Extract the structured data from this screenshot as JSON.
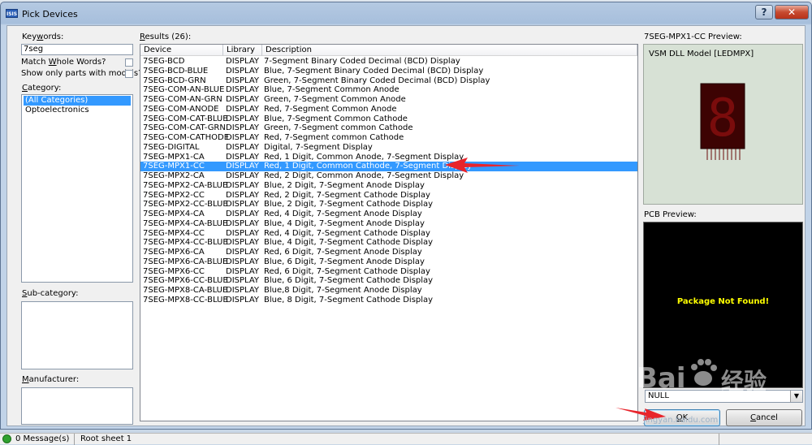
{
  "window": {
    "logo_text": "ISIS",
    "title": "Pick Devices",
    "help_label": "?",
    "close_label": "✕"
  },
  "keywords": {
    "label_prefix": "Key",
    "label_accel": "w",
    "label_suffix": "ords:",
    "value": "7seg"
  },
  "options": {
    "match_whole_prefix": "Match ",
    "match_whole_accel": "W",
    "match_whole_suffix": "hole Words?",
    "show_models": "Show only parts with models?"
  },
  "category": {
    "label_accel": "C",
    "label_suffix": "ategory:",
    "items": [
      "(All Categories)",
      "Optoelectronics"
    ],
    "selected_index": 0
  },
  "subcategory": {
    "label_accel": "S",
    "label_suffix": "ub-category:"
  },
  "manufacturer": {
    "label_accel": "M",
    "label_suffix": "anufacturer:"
  },
  "results": {
    "label_accel": "R",
    "label_suffix": "esults (26):",
    "headers": [
      "Device",
      "Library",
      "Description"
    ],
    "selected_index": 11,
    "rows": [
      {
        "device": "7SEG-BCD",
        "library": "DISPLAY",
        "description": "7-Segment Binary Coded Decimal (BCD) Display"
      },
      {
        "device": "7SEG-BCD-BLUE",
        "library": "DISPLAY",
        "description": "Blue,  7-Segment Binary Coded Decimal (BCD) Display"
      },
      {
        "device": "7SEG-BCD-GRN",
        "library": "DISPLAY",
        "description": "Green, 7-Segment Binary Coded Decimal (BCD) Display"
      },
      {
        "device": "7SEG-COM-AN-BLUE",
        "library": "DISPLAY",
        "description": "Blue, 7-Segment Common Anode"
      },
      {
        "device": "7SEG-COM-AN-GRN",
        "library": "DISPLAY",
        "description": "Green, 7-Segment Common Anode"
      },
      {
        "device": "7SEG-COM-ANODE",
        "library": "DISPLAY",
        "description": "Red, 7-Segment Common Anode"
      },
      {
        "device": "7SEG-COM-CAT-BLUE",
        "library": "DISPLAY",
        "description": "Blue, 7-Segment Common Cathode"
      },
      {
        "device": "7SEG-COM-CAT-GRN",
        "library": "DISPLAY",
        "description": "Green, 7-Segment common Cathode"
      },
      {
        "device": "7SEG-COM-CATHODE",
        "library": "DISPLAY",
        "description": "Red, 7-Segment common Cathode"
      },
      {
        "device": "7SEG-DIGITAL",
        "library": "DISPLAY",
        "description": "Digital, 7-Segment Display"
      },
      {
        "device": "7SEG-MPX1-CA",
        "library": "DISPLAY",
        "description": "Red, 1 Digit, Common Anode, 7-Segment Display"
      },
      {
        "device": "7SEG-MPX1-CC",
        "library": "DISPLAY",
        "description": "Red, 1 Digit, Common Cathode, 7-Segment Display"
      },
      {
        "device": "7SEG-MPX2-CA",
        "library": "DISPLAY",
        "description": "Red, 2 Digit, Common Anode, 7-Segment Display"
      },
      {
        "device": "7SEG-MPX2-CA-BLUE",
        "library": "DISPLAY",
        "description": "Blue, 2 Digit, 7-Segment Anode Display"
      },
      {
        "device": "7SEG-MPX2-CC",
        "library": "DISPLAY",
        "description": "Red, 2 Digit, 7-Segment Cathode Display"
      },
      {
        "device": "7SEG-MPX2-CC-BLUE",
        "library": "DISPLAY",
        "description": "Blue, 2 Digit, 7-Segment Cathode Display"
      },
      {
        "device": "7SEG-MPX4-CA",
        "library": "DISPLAY",
        "description": "Red, 4 Digit, 7-Segment Anode Display"
      },
      {
        "device": "7SEG-MPX4-CA-BLUE",
        "library": "DISPLAY",
        "description": "Blue, 4 Digit, 7-Segment Anode Display"
      },
      {
        "device": "7SEG-MPX4-CC",
        "library": "DISPLAY",
        "description": "Red, 4 Digit, 7-Segment Cathode Display"
      },
      {
        "device": "7SEG-MPX4-CC-BLUE",
        "library": "DISPLAY",
        "description": "Blue, 4 Digit, 7-Segment Cathode Display"
      },
      {
        "device": "7SEG-MPX6-CA",
        "library": "DISPLAY",
        "description": "Red, 6 Digit, 7-Segment Anode Display"
      },
      {
        "device": "7SEG-MPX6-CA-BLUE",
        "library": "DISPLAY",
        "description": "Blue, 6 Digit, 7-Segment Anode Display"
      },
      {
        "device": "7SEG-MPX6-CC",
        "library": "DISPLAY",
        "description": "Red, 6 Digit, 7-Segment Cathode Display"
      },
      {
        "device": "7SEG-MPX6-CC-BLUE",
        "library": "DISPLAY",
        "description": "Blue, 6 Digit, 7-Segment Cathode Display"
      },
      {
        "device": "7SEG-MPX8-CA-BLUE",
        "library": "DISPLAY",
        "description": "Blue,8 Digit, 7-Segment Anode Display"
      },
      {
        "device": "7SEG-MPX8-CC-BLUE",
        "library": "DISPLAY",
        "description": "Blue, 8 Digit, 7-Segment Cathode Display"
      }
    ]
  },
  "preview": {
    "label": "7SEG-MPX1-CC Preview:",
    "model": "VSM DLL Model [LEDMPX]",
    "digit": "8"
  },
  "pcb": {
    "label": "PCB Preview:",
    "message": "Package Not Found!",
    "package_value": "NULL"
  },
  "buttons": {
    "ok_accel": "O",
    "ok_suffix": "K",
    "cancel_accel": "C",
    "cancel_suffix": "ancel"
  },
  "watermark": {
    "brand": "Bai",
    "brand_cn": "经验",
    "url": "jingyan.baidu.com"
  },
  "statusbar": {
    "messages": "0 Message(s)",
    "sheet": "Root sheet 1"
  },
  "colors": {
    "selection": "#3399ff",
    "annotation_arrow": "#e8242b",
    "pcb_text": "#ffff00",
    "led_segment": "#7a0c0c"
  }
}
